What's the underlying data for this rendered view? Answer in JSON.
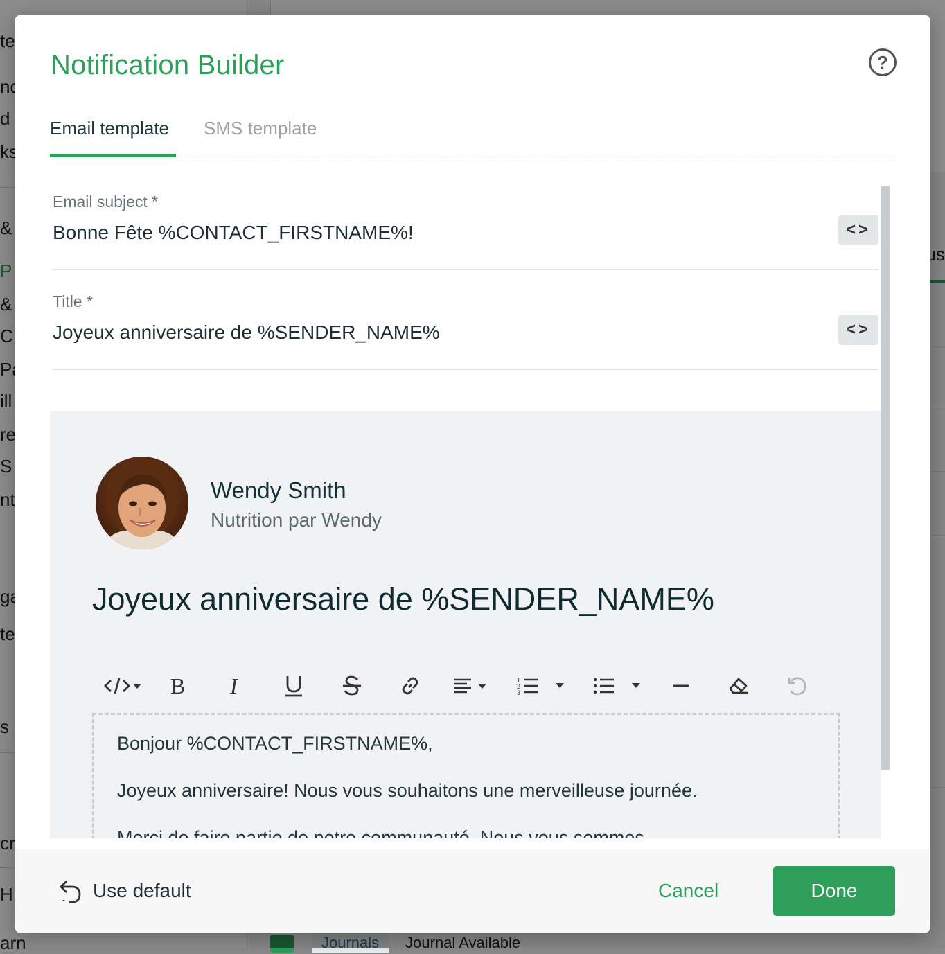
{
  "background": {
    "sidebar_fragments": [
      "te",
      "nd",
      "d",
      "ks",
      "& I",
      "P",
      "& I",
      "C",
      "Pa",
      "ill",
      "re",
      "S",
      "nt",
      "ga",
      "te",
      "s D",
      "cri",
      "H",
      "arn"
    ],
    "right_tab_fragment": "us",
    "bottom_chip": "Journals",
    "bottom_text": "Journal Available"
  },
  "modal": {
    "title": "Notification Builder",
    "help_icon": "?",
    "tabs": [
      {
        "label": "Email template",
        "active": true
      },
      {
        "label": "SMS template",
        "active": false
      }
    ],
    "email_subject": {
      "label": "Email subject *",
      "value": "Bonne Fête %CONTACT_FIRSTNAME%!"
    },
    "title_field": {
      "label": "Title *",
      "value": "Joyeux anniversaire de %SENDER_NAME%"
    },
    "code_button_glyph": "<>",
    "preview": {
      "sender_name": "Wendy Smith",
      "sender_company": "Nutrition par Wendy",
      "heading": "Joyeux anniversaire de %SENDER_NAME%",
      "toolbar": [
        "code-view",
        "bold",
        "italic",
        "underline",
        "strikethrough",
        "link",
        "align",
        "ordered-list",
        "bullet-list",
        "horizontal-rule",
        "clear-format",
        "undo"
      ],
      "body": [
        "Bonjour %CONTACT_FIRSTNAME%,",
        "Joyeux anniversaire! Nous vous souhaitons une merveilleuse journée.",
        "Merci de faire partie de notre communauté. Nous vous sommes"
      ]
    },
    "footer": {
      "use_default": "Use default",
      "cancel": "Cancel",
      "done": "Done"
    }
  },
  "colors": {
    "accent": "#2e9e5b",
    "text_dark": "#1e2e33",
    "preview_bg": "#f1f2f3"
  }
}
